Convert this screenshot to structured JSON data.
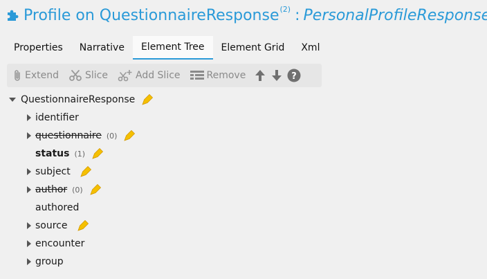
{
  "header": {
    "title_main": "Profile on QuestionnaireResponse",
    "title_sup": "(2)",
    "title_colon": ":",
    "title_type": "PersonalProfileResponse",
    "icon": "puzzle-piece-icon",
    "accent_color": "#2a9ad8"
  },
  "tabs": [
    {
      "label": "Properties"
    },
    {
      "label": "Narrative"
    },
    {
      "label": "Element Tree",
      "active": true
    },
    {
      "label": "Element Grid"
    },
    {
      "label": "Xml"
    }
  ],
  "toolbar": {
    "extend_label": "Extend",
    "slice_label": "Slice",
    "add_slice_label": "Add Slice",
    "remove_label": "Remove"
  },
  "tree": {
    "root": {
      "label": "QuestionnaireResponse"
    },
    "items": [
      {
        "label": "identifier"
      },
      {
        "label": "questionnaire",
        "card": "(0)"
      },
      {
        "label": "status",
        "card": "(1)"
      },
      {
        "label": "subject"
      },
      {
        "label": "author",
        "card": "(0)"
      },
      {
        "label": "authored"
      },
      {
        "label": "source"
      },
      {
        "label": "encounter"
      },
      {
        "label": "group"
      }
    ]
  }
}
